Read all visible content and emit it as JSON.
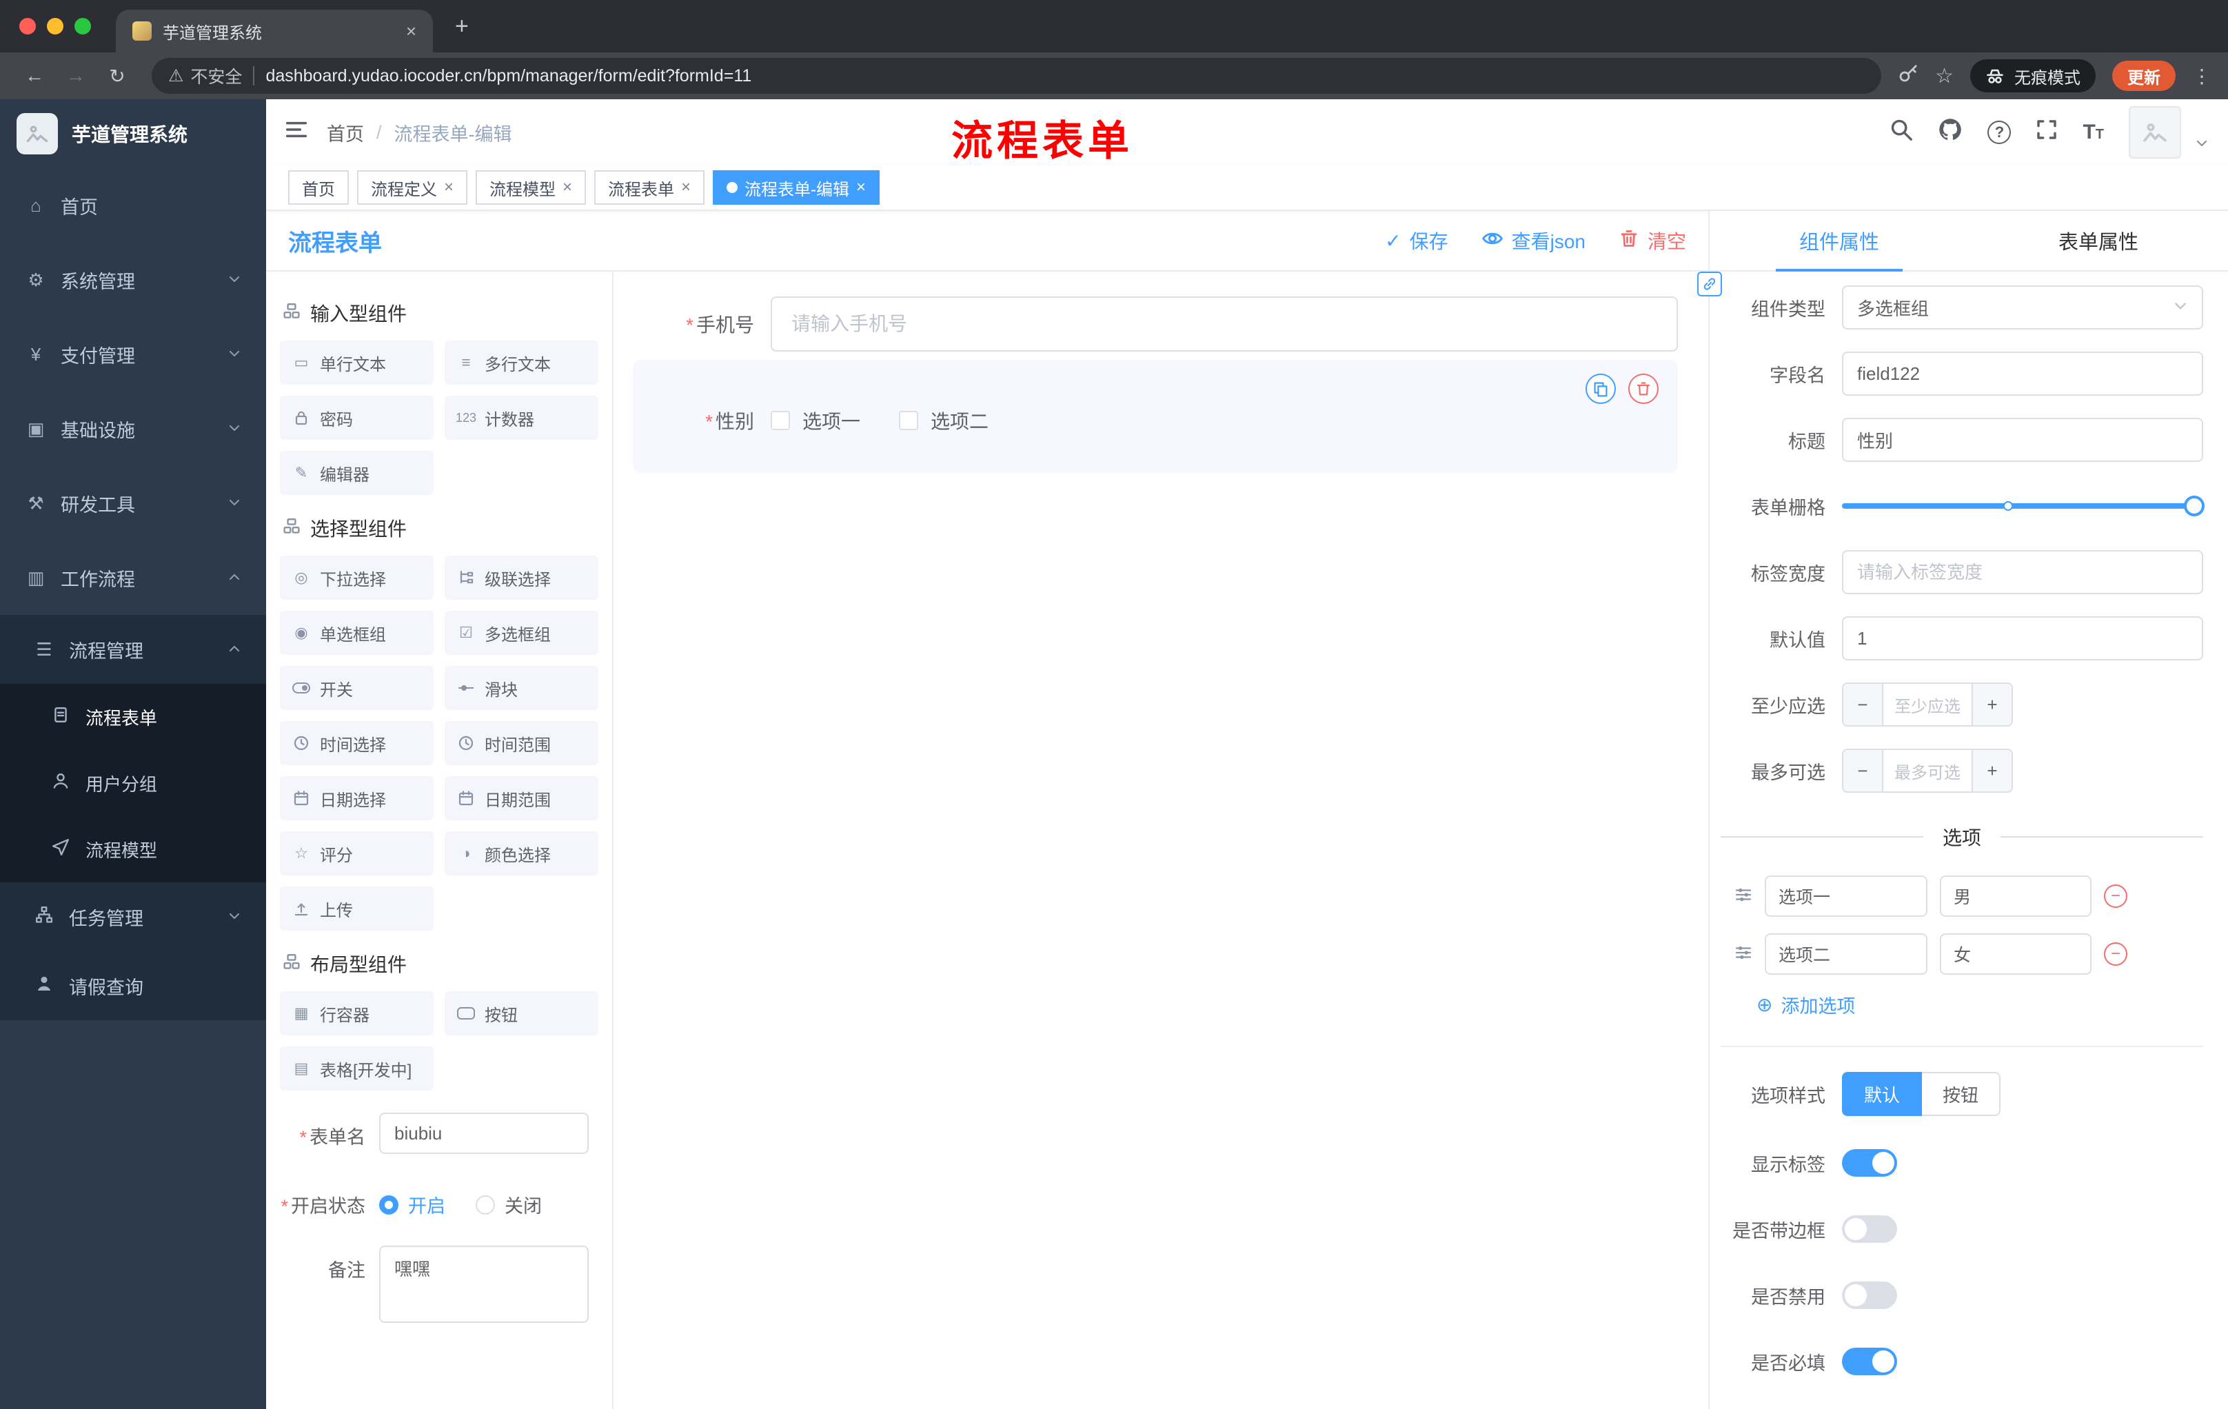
{
  "colors": {
    "accent": "#409eff",
    "danger": "#f56c6c",
    "sidebar": "#2d3a4b",
    "annotation": "#fe0000",
    "update_badge": "#e25a33"
  },
  "icons": {
    "close": "×",
    "plus": "+",
    "back": "←",
    "forward": "→",
    "reload": "↻",
    "warning": "⚠",
    "star": "☆",
    "menu_dots": "⋮",
    "check": "✓",
    "breadcrumb_sep": "/",
    "question": "?",
    "asterisk": "*",
    "minus": "−",
    "add_circle": "⊕",
    "home": "⌂",
    "gear": "⚙",
    "yen": "¥",
    "infra": "▣",
    "tools": "⚒",
    "workflow": "▥",
    "list": "☰",
    "single_text": "▭",
    "multi_text": "≡",
    "counter": "123",
    "editor": "✎",
    "select": "◎",
    "radio_group": "◉",
    "checkbox_group": "☑",
    "rate": "☆",
    "color_picker": "◑",
    "row_container": "▦",
    "table": "▤",
    "text_size": "T"
  },
  "browser": {
    "tab_title": "芋道管理系统",
    "security": "不安全",
    "url": "dashboard.yudao.iocoder.cn/bpm/manager/form/edit?formId=11",
    "incognito": "无痕模式",
    "update": "更新"
  },
  "sidebar": {
    "logo": "芋道管理系统",
    "items": [
      {
        "label": "首页"
      },
      {
        "label": "系统管理"
      },
      {
        "label": "支付管理"
      },
      {
        "label": "基础设施"
      },
      {
        "label": "研发工具"
      },
      {
        "label": "工作流程"
      }
    ],
    "process_mgmt": {
      "label": "流程管理",
      "children": [
        {
          "label": "流程表单"
        },
        {
          "label": "用户分组"
        },
        {
          "label": "流程模型"
        }
      ]
    },
    "task_mgmt": {
      "label": "任务管理"
    },
    "leave_query": {
      "label": "请假查询"
    }
  },
  "header": {
    "breadcrumb": [
      "首页",
      "流程表单-编辑"
    ],
    "annotation": "流程表单"
  },
  "tags": [
    {
      "label": "首页"
    },
    {
      "label": "流程定义"
    },
    {
      "label": "流程模型"
    },
    {
      "label": "流程表单"
    },
    {
      "label": "流程表单-编辑"
    }
  ],
  "designer": {
    "title": "流程表单",
    "actions": {
      "save": "保存",
      "view_json": "查看json",
      "clear": "清空"
    },
    "groups": [
      {
        "title": "输入型组件",
        "items": [
          "单行文本",
          "多行文本",
          "密码",
          "计数器",
          "编辑器"
        ]
      },
      {
        "title": "选择型组件",
        "items": [
          "下拉选择",
          "级联选择",
          "单选框组",
          "多选框组",
          "开关",
          "滑块",
          "时间选择",
          "时间范围",
          "日期选择",
          "日期范围",
          "评分",
          "颜色选择",
          "上传"
        ]
      },
      {
        "title": "布局型组件",
        "items": [
          "行容器",
          "按钮",
          "表格[开发中]"
        ]
      }
    ],
    "meta": {
      "name_label": "表单名",
      "name_value": "biubiu",
      "status_label": "开启状态",
      "status_on": "开启",
      "status_off": "关闭",
      "remark_label": "备注",
      "remark_value": "嘿嘿"
    },
    "canvas": {
      "phone_label": "手机号",
      "phone_placeholder": "请输入手机号",
      "gender_label": "性别",
      "gender_options": [
        "选项一",
        "选项二"
      ]
    }
  },
  "props": {
    "tab_component": "组件属性",
    "tab_form": "表单属性",
    "component_type_label": "组件类型",
    "component_type_value": "多选框组",
    "field_name_label": "字段名",
    "field_name_value": "field122",
    "title_label": "标题",
    "title_value": "性别",
    "grid_label": "表单栅格",
    "label_width_label": "标签宽度",
    "label_width_placeholder": "请输入标签宽度",
    "default_label": "默认值",
    "default_value": "1",
    "min_label": "至少应选",
    "min_placeholder": "至少应选",
    "max_label": "最多可选",
    "max_placeholder": "最多可选",
    "options_title": "选项",
    "options": [
      {
        "label": "选项一",
        "value": "男"
      },
      {
        "label": "选项二",
        "value": "女"
      }
    ],
    "add_option": "添加选项",
    "style_label": "选项样式",
    "style_default": "默认",
    "style_button": "按钮",
    "toggles": [
      {
        "label": "显示标签",
        "on": true
      },
      {
        "label": "是否带边框",
        "on": false
      },
      {
        "label": "是否禁用",
        "on": false
      },
      {
        "label": "是否必填",
        "on": true
      }
    ]
  }
}
